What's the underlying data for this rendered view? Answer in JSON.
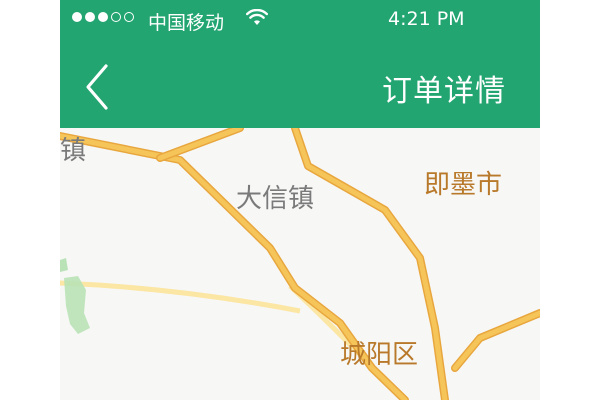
{
  "status_bar": {
    "signal_bars_filled": 3,
    "signal_bars_total": 5,
    "carrier": "中国移动",
    "time": "4:21 PM"
  },
  "nav": {
    "title": "订单详情",
    "back_icon": "chevron-left-icon"
  },
  "map": {
    "labels": {
      "town_left_partial": "镇",
      "daxin": "大信镇",
      "jimo": "即墨市",
      "chengyang": "城阳区"
    }
  },
  "colors": {
    "header_bg": "#23a571",
    "map_bg": "#f7f7f6",
    "road_major": "#f3b94a",
    "road_minor": "#fbe6a4",
    "label_city": "#b9792a",
    "label_town": "#7a7a7a"
  }
}
